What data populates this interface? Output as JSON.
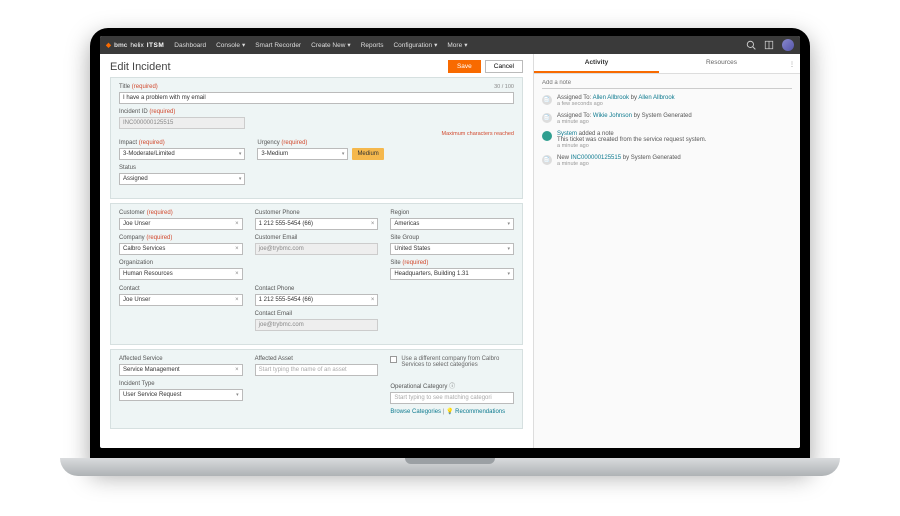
{
  "brand": {
    "bmc": "bmc",
    "helix": "helix",
    "product": "ITSM"
  },
  "nav": {
    "items": [
      "Dashboard",
      "Console",
      "Smart Recorder",
      "Create New",
      "Reports",
      "Configuration",
      "More"
    ],
    "dropdown_idx": [
      1,
      3,
      5,
      6
    ]
  },
  "header": {
    "title": "Edit Incident",
    "save": "Save",
    "cancel": "Cancel"
  },
  "form": {
    "title": {
      "label": "Title",
      "value": "I have a problem with my email",
      "counter": "30 / 100"
    },
    "incident_id": {
      "label": "Incident ID",
      "value": "INC000000125515",
      "max_msg": "Maximum characters reached"
    },
    "impact": {
      "label": "Impact",
      "value": "3-Moderate/Limited"
    },
    "urgency": {
      "label": "Urgency",
      "value": "3-Medium"
    },
    "priority_badge": "Medium",
    "status": {
      "label": "Status",
      "value": "Assigned"
    },
    "customer": {
      "label": "Customer",
      "value": "Joe Unser"
    },
    "customer_phone": {
      "label": "Customer Phone",
      "value": "1 212 555-5454 (66)"
    },
    "region": {
      "label": "Region",
      "value": "Americas"
    },
    "company": {
      "label": "Company",
      "value": "Calbro Services"
    },
    "customer_email": {
      "label": "Customer Email",
      "value": "joe@trybmc.com"
    },
    "site_group": {
      "label": "Site Group",
      "value": "United States"
    },
    "organization": {
      "label": "Organization",
      "value": "Human Resources"
    },
    "site": {
      "label": "Site",
      "value": "Headquarters, Building 1.31"
    },
    "contact": {
      "label": "Contact",
      "value": "Joe Unser"
    },
    "contact_phone": {
      "label": "Contact Phone",
      "value": "1 212 555-5454 (66)"
    },
    "contact_email": {
      "label": "Contact Email",
      "value": "joe@trybmc.com"
    },
    "affected_service": {
      "label": "Affected Service",
      "value": "Service Management"
    },
    "affected_asset": {
      "label": "Affected Asset",
      "placeholder": "Start typing the name of an asset"
    },
    "use_diff_company": "Use a different company from Calbro Services to select categories",
    "op_category": {
      "label": "Operational Category",
      "placeholder": "Start typing to see matching categori"
    },
    "incident_type": {
      "label": "Incident Type",
      "value": "User Service Request"
    },
    "browse_categories": "Browse Categories",
    "recommendations": "Recommendations"
  },
  "right": {
    "tabs": {
      "activity": "Activity",
      "resources": "Resources"
    },
    "add_note_placeholder": "Add a note",
    "items": [
      {
        "kind": "assign",
        "prefix": "Assigned To:",
        "who": "Allen Allbrook",
        "by": "by",
        "by_who": "Allen Allbrook",
        "time": "a few seconds ago"
      },
      {
        "kind": "assign",
        "prefix": "Assigned To:",
        "who": "Wikie Johnson",
        "by": "by System Generated",
        "by_who": "",
        "time": "a minute ago"
      },
      {
        "kind": "note",
        "who": "System",
        "suffix": " added a note",
        "body": "This ticket was created from the service request system.",
        "time": "a minute ago"
      },
      {
        "kind": "new",
        "prefix": "New ",
        "id": "INC000000125515",
        "suffix": " by System Generated",
        "time": "a minute ago"
      }
    ]
  }
}
